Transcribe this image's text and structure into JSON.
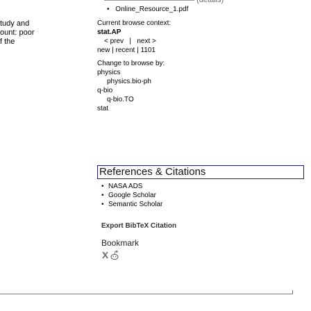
{
  "left": {
    "lines": [
      "tudy and",
      "ount: poor",
      "f the"
    ]
  },
  "top": {
    "partial_text": "                   (details)",
    "file_item": "Online_Resource_1.pdf"
  },
  "browse": {
    "context_label": "Current browse context:",
    "context_value": "stat.AP",
    "prev_label": "< prev",
    "separator": "|",
    "next_label": "next >",
    "new_label": "new",
    "recent_label": "recent",
    "recent_id": "1101",
    "change_label": "Change to browse by:",
    "tree": [
      {
        "label": "physics",
        "level": 1
      },
      {
        "label": "physics.bio-ph",
        "level": 2
      },
      {
        "label": "q-bio",
        "level": 1
      },
      {
        "label": "q-bio.TO",
        "level": 2
      },
      {
        "label": "stat",
        "level": 1
      }
    ]
  },
  "refs": {
    "title": "References & Citations",
    "items": [
      "NASA ADS",
      "Google Scholar",
      "Semantic Scholar"
    ]
  },
  "bibtex_label": "Export BibTeX Citation",
  "bookmark": {
    "title": "Bookmark",
    "icons": [
      "x-icon",
      "reddit-icon"
    ]
  }
}
